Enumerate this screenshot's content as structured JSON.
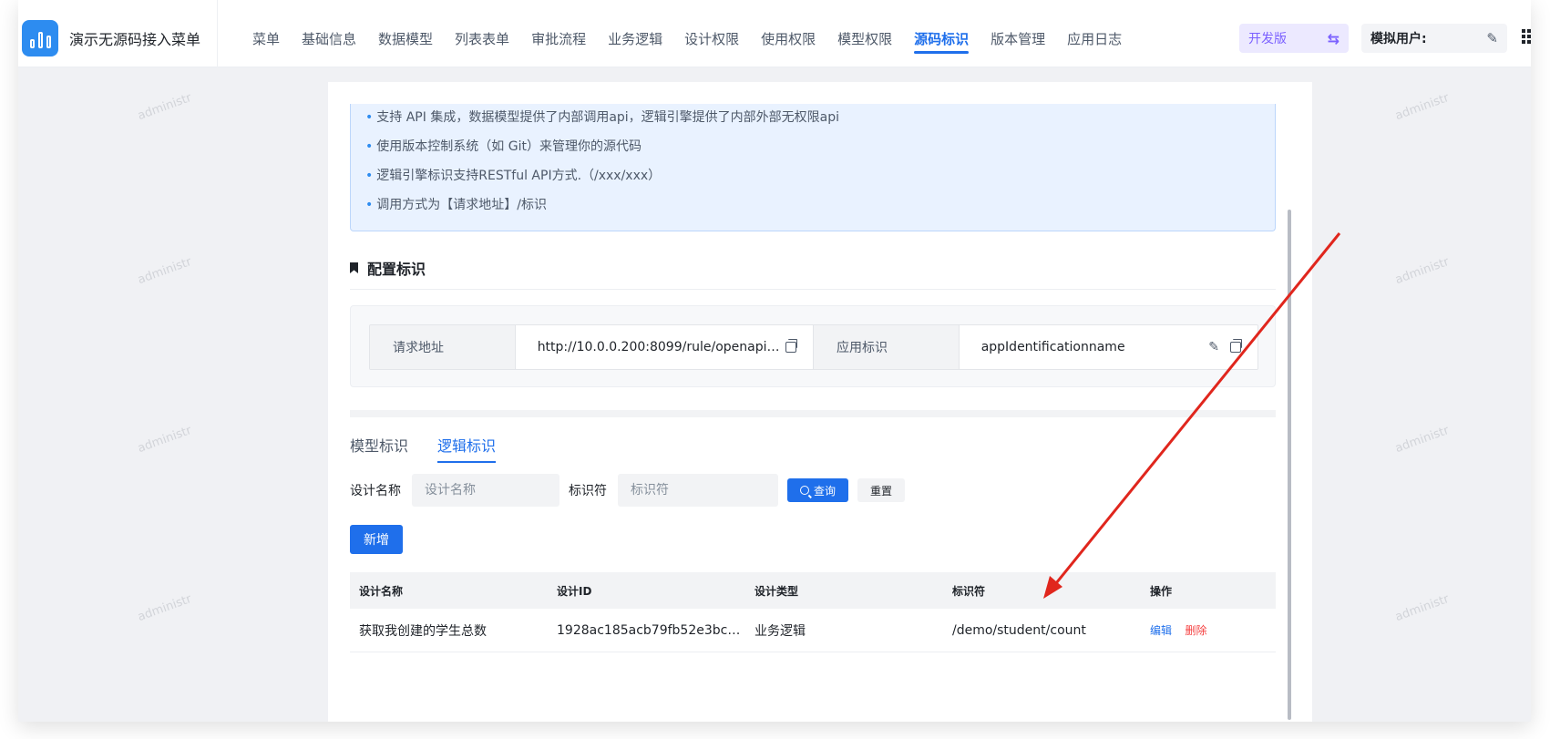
{
  "app": {
    "title": "演示无源码接入菜单"
  },
  "nav": {
    "items": [
      {
        "label": "菜单",
        "active": false
      },
      {
        "label": "基础信息",
        "active": false
      },
      {
        "label": "数据模型",
        "active": false
      },
      {
        "label": "列表表单",
        "active": false
      },
      {
        "label": "审批流程",
        "active": false
      },
      {
        "label": "业务逻辑",
        "active": false
      },
      {
        "label": "设计权限",
        "active": false
      },
      {
        "label": "使用权限",
        "active": false
      },
      {
        "label": "模型权限",
        "active": false
      },
      {
        "label": "源码标识",
        "active": true
      },
      {
        "label": "版本管理",
        "active": false
      },
      {
        "label": "应用日志",
        "active": false
      }
    ]
  },
  "header": {
    "env_label": "开发版",
    "user_label": "模拟用户:"
  },
  "watermark": "administr",
  "notice": {
    "lines": [
      "支持 API 集成，数据模型提供了内部调用api，逻辑引擎提供了内部外部无权限api",
      "使用版本控制系统（如 Git）来管理你的源代码",
      "逻辑引擎标识支持RESTful API方式.（/xxx/xxx）",
      "调用方式为【请求地址】/标识"
    ]
  },
  "config": {
    "section_title": "配置标识",
    "request_url_label": "请求地址",
    "request_url_value": "http://10.0.0.200:8099/rule/openapi/a...",
    "app_id_label": "应用标识",
    "app_id_value": "appIdentificationname"
  },
  "tabs": [
    {
      "label": "模型标识",
      "active": false
    },
    {
      "label": "逻辑标识",
      "active": true
    }
  ],
  "search": {
    "design_name_label": "设计名称",
    "design_name_placeholder": "设计名称",
    "identifier_label": "标识符",
    "identifier_placeholder": "标识符",
    "query_label": "查询",
    "reset_label": "重置"
  },
  "add_label": "新增",
  "table": {
    "columns": [
      "设计名称",
      "设计ID",
      "设计类型",
      "标识符",
      "操作"
    ],
    "rows": [
      {
        "name": "获取我创建的学生总数",
        "id": "1928ac185acb79fb52e3bc6...",
        "type": "业务逻辑",
        "identifier": "/demo/student/count",
        "edit": "编辑",
        "delete": "删除"
      }
    ]
  },
  "colors": {
    "primary": "#1f6feb",
    "danger": "#f53f3f",
    "env_accent": "#7b61ff",
    "annotation_arrow": "#e0261d"
  }
}
